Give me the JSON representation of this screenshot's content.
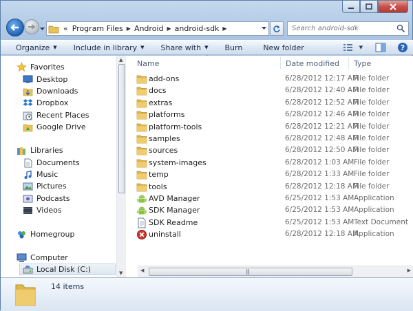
{
  "window": {
    "caption_buttons": [
      "minimize",
      "maximize",
      "close"
    ]
  },
  "address_bar": {
    "prefix": "«",
    "crumbs": [
      "Program Files",
      "Android",
      "android-sdk"
    ]
  },
  "search": {
    "placeholder": "Search android-sdk"
  },
  "toolbar": {
    "organize": "Organize",
    "include_in_library": "Include in library",
    "share_with": "Share with",
    "burn": "Burn",
    "new_folder": "New folder"
  },
  "nav": {
    "favorites": "Favorites",
    "favorites_items": [
      "Desktop",
      "Downloads",
      "Dropbox",
      "Recent Places",
      "Google Drive"
    ],
    "libraries": "Libraries",
    "libraries_items": [
      "Documents",
      "Music",
      "Pictures",
      "Podcasts",
      "Videos"
    ],
    "homegroup": "Homegroup",
    "computer": "Computer",
    "computer_items": [
      "Local Disk (C:)"
    ]
  },
  "columns": {
    "name": "Name",
    "date": "Date modified",
    "type": "Type"
  },
  "files": [
    {
      "name": "add-ons",
      "date": "6/28/2012 12:17 AM",
      "type": "File folder",
      "icon": "folder-icon"
    },
    {
      "name": "docs",
      "date": "6/28/2012 12:40 AM",
      "type": "File folder",
      "icon": "folder-icon"
    },
    {
      "name": "extras",
      "date": "6/28/2012 12:52 AM",
      "type": "File folder",
      "icon": "folder-icon"
    },
    {
      "name": "platforms",
      "date": "6/28/2012 12:46 AM",
      "type": "File folder",
      "icon": "folder-icon"
    },
    {
      "name": "platform-tools",
      "date": "6/28/2012 12:21 AM",
      "type": "File folder",
      "icon": "folder-icon"
    },
    {
      "name": "samples",
      "date": "6/28/2012 12:48 AM",
      "type": "File folder",
      "icon": "folder-icon"
    },
    {
      "name": "sources",
      "date": "6/28/2012 12:50 AM",
      "type": "File folder",
      "icon": "folder-icon"
    },
    {
      "name": "system-images",
      "date": "6/28/2012 1:03 AM",
      "type": "File folder",
      "icon": "folder-icon"
    },
    {
      "name": "temp",
      "date": "6/28/2012 1:33 AM",
      "type": "File folder",
      "icon": "folder-icon"
    },
    {
      "name": "tools",
      "date": "6/28/2012 12:18 AM",
      "type": "File folder",
      "icon": "folder-icon"
    },
    {
      "name": "AVD Manager",
      "date": "6/25/2012 1:53 AM",
      "type": "Application",
      "icon": "android-icon"
    },
    {
      "name": "SDK Manager",
      "date": "6/25/2012 1:53 AM",
      "type": "Application",
      "icon": "android-icon"
    },
    {
      "name": "SDK Readme",
      "date": "6/25/2012 1:53 AM",
      "type": "Text Document",
      "icon": "text-document-icon"
    },
    {
      "name": "uninstall",
      "date": "6/28/2012 12:18 AM",
      "type": "Application",
      "icon": "uninstall-icon"
    }
  ],
  "details": {
    "count": "14 items"
  },
  "colors": {
    "folder": "#e8c35a",
    "android": "#8ac43f",
    "uninstall": "#d0342c",
    "accent": "#1f62b6"
  }
}
